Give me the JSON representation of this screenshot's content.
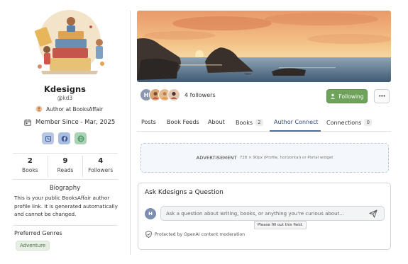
{
  "profile": {
    "name": "Kdesigns",
    "handle": "@kd3",
    "author_at": "Author at BooksAffair",
    "member_since": "Member Since - Mar, 2025",
    "social_icons": [
      "goodreads-icon",
      "facebook-icon",
      "website-icon"
    ],
    "stats": [
      {
        "value": "2",
        "label": "Books"
      },
      {
        "value": "9",
        "label": "Reads"
      },
      {
        "value": "4",
        "label": "Followers"
      }
    ],
    "bio_title": "Biography",
    "bio_text": "This is your public BooksAffair author profile link. It is generated automatically and cannot be changed.",
    "genres_title": "Preferred Genres",
    "genres": [
      "Adventure"
    ]
  },
  "followers": {
    "avatar_initial": "H",
    "count_text": "4 followers"
  },
  "actions": {
    "following_label": "Following",
    "more_label": "•••"
  },
  "tabs": {
    "posts": "Posts",
    "book_feeds": "Book Feeds",
    "about": "About",
    "books": "Books",
    "books_count": "2",
    "author_connect": "Author Connect",
    "connections": "Connections",
    "connections_count": "0",
    "active": "Author Connect"
  },
  "ad": {
    "label": "ADVERTISEMENT",
    "sub": "728 × 90px (Profile, horizontal) or Portal widget"
  },
  "question": {
    "title": "Ask Kdesigns a Question",
    "avatar_initial": "H",
    "placeholder": "Ask a question about writing, books, or anything you're curious about...",
    "tooltip": "Please fill out this field.",
    "protected_text": "Protected by OpenAI content moderation"
  },
  "colors": {
    "accent_green": "#6fa25a",
    "tab_underline": "#4d6a9a"
  }
}
